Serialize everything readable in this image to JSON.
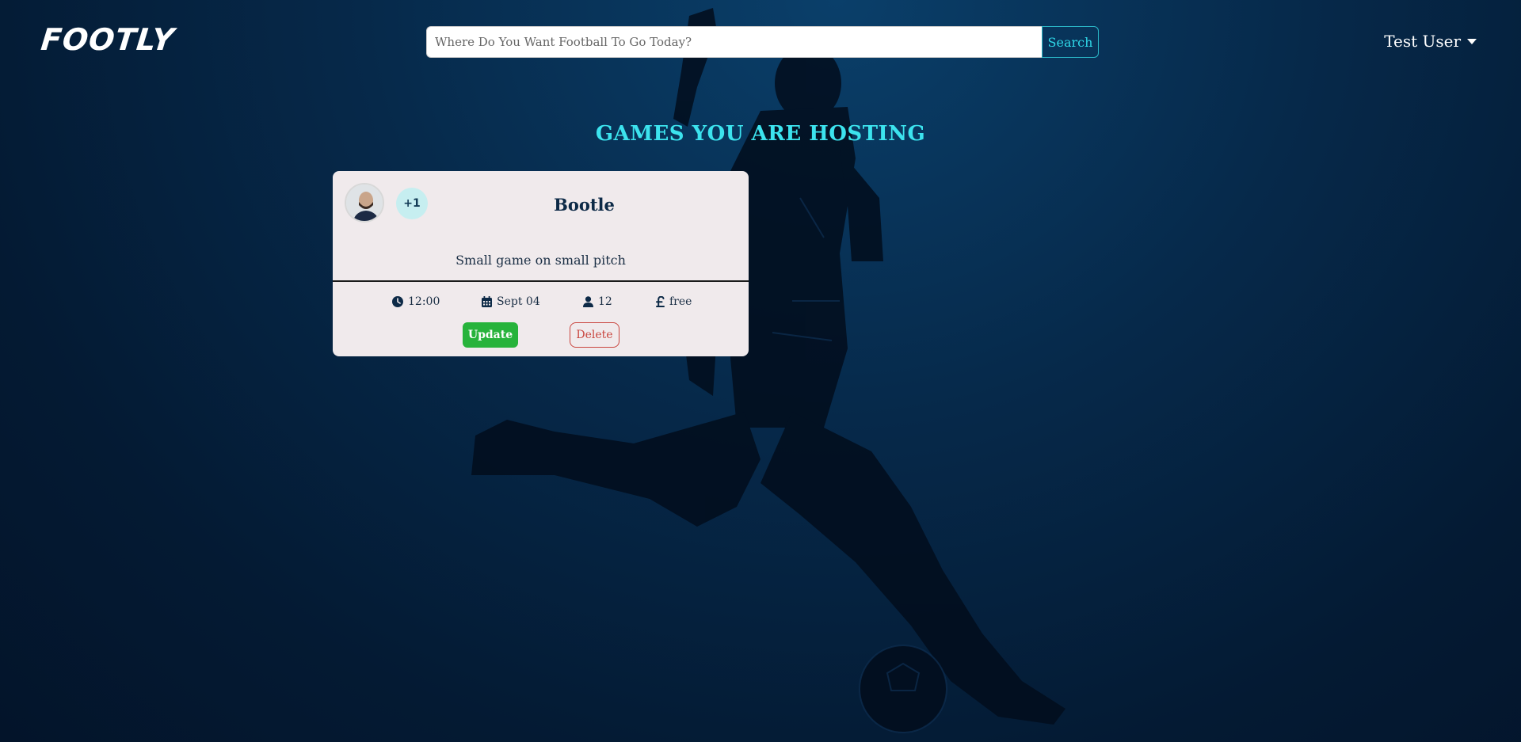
{
  "header": {
    "logo": "FOOTLY",
    "search": {
      "placeholder": "Where Do You Want Football To Go Today?",
      "value": "",
      "button_label": "Search"
    },
    "user_menu": {
      "label": "Test User",
      "icon": "caret-down-icon"
    }
  },
  "main": {
    "section_title": "GAMES YOU ARE HOSTING",
    "games": [
      {
        "extra_players_badge": "+1",
        "title": "Bootle",
        "description": "Small game on small pitch",
        "time": {
          "icon": "clock-icon",
          "value": "12:00"
        },
        "date": {
          "icon": "calendar-icon",
          "value": "Sept 04"
        },
        "players": {
          "icon": "user-icon",
          "value": "12"
        },
        "price": {
          "icon": "pound-icon",
          "value": "free"
        },
        "actions": {
          "update_label": "Update",
          "delete_label": "Delete"
        }
      }
    ]
  },
  "colors": {
    "accent": "#3ce3ee",
    "update_button": "#27b33b",
    "delete_button": "#c9463f",
    "card_background": "#f0eaec",
    "page_background": "#06294a"
  }
}
